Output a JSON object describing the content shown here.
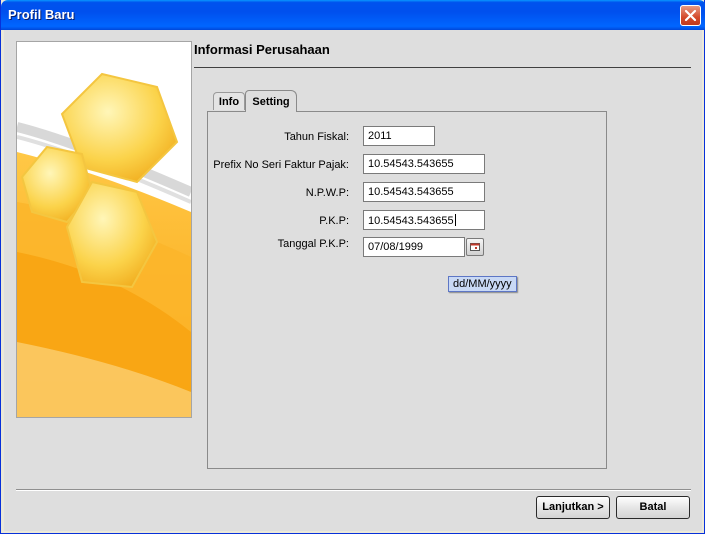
{
  "window": {
    "title": "Profil Baru"
  },
  "header": {
    "title": "Informasi Perusahaan"
  },
  "tabs": [
    {
      "label": "Info",
      "active": false
    },
    {
      "label": "Setting",
      "active": true
    }
  ],
  "form": {
    "fiscal_year": {
      "label": "Tahun Fiskal:",
      "value": "2011"
    },
    "tax_prefix": {
      "label": "Prefix No Seri Faktur Pajak:",
      "value": "10.54543.543655"
    },
    "npwp": {
      "label": "N.P.W.P:",
      "value": "10.54543.543655"
    },
    "pkp": {
      "label": "P.K.P:",
      "value": "10.54543.543655"
    },
    "pkp_date": {
      "label": "Tanggal P.K.P:",
      "value": "07/08/1999"
    }
  },
  "tooltip": {
    "text": "dd/MM/yyyy"
  },
  "buttons": {
    "next_label": "Lanjutkan >",
    "cancel_label": "Batal"
  },
  "colors": {
    "titlebar": "#0053ee",
    "accent_gold": "#f9c42b",
    "background": "#dedede"
  }
}
